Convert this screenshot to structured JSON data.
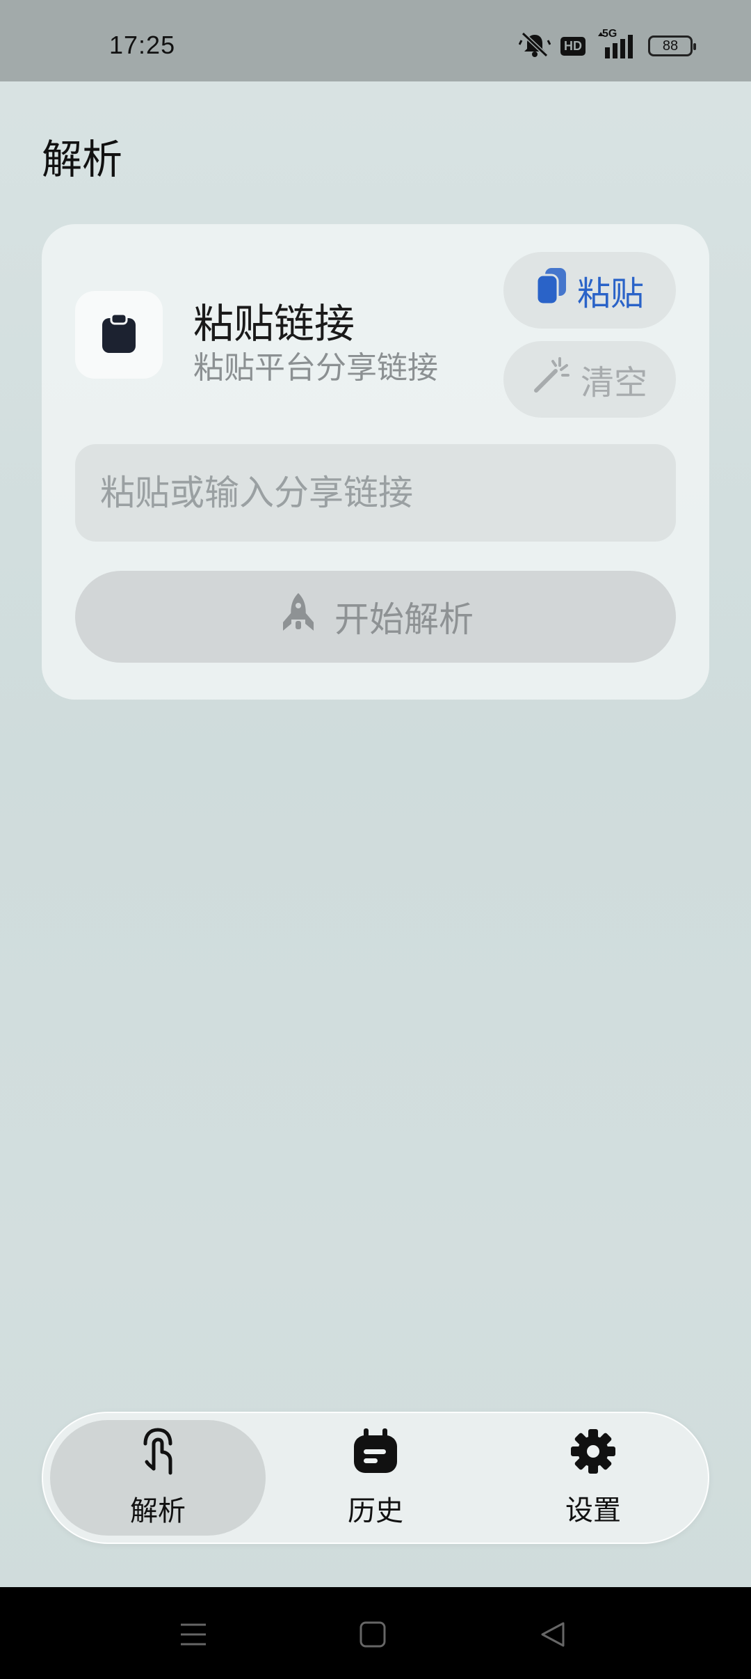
{
  "status_bar": {
    "time": "17:25",
    "hd": "HD",
    "network": "5G",
    "battery": "88"
  },
  "page": {
    "title": "解析"
  },
  "card": {
    "title": "粘贴链接",
    "subtitle": "粘贴平台分享链接",
    "paste_label": "粘贴",
    "clear_label": "清空",
    "input_placeholder": "粘贴或输入分享链接",
    "input_value": "",
    "start_label": "开始解析"
  },
  "tabbar": {
    "tabs": [
      {
        "label": "解析",
        "icon": "touch-icon",
        "active": true
      },
      {
        "label": "历史",
        "icon": "calendar-icon",
        "active": false
      },
      {
        "label": "设置",
        "icon": "gear-icon",
        "active": false
      }
    ]
  },
  "colors": {
    "accent": "#2a63c8",
    "background": "#d3dede",
    "status_bar": "#a2aaaa"
  }
}
